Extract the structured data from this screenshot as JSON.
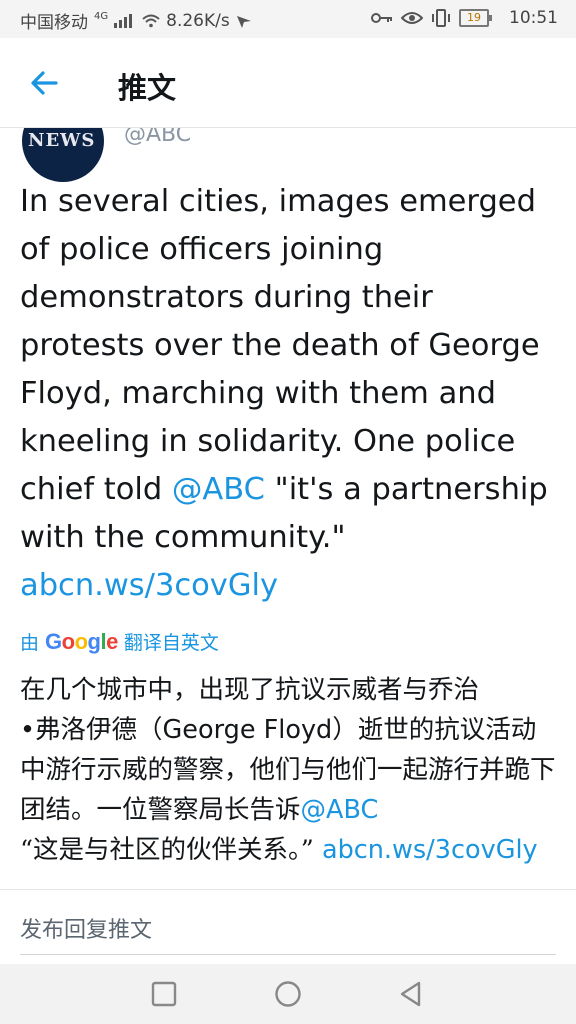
{
  "status_bar": {
    "carrier": "中国移动",
    "network": "4G",
    "speed": "8.26K/s",
    "battery": "19",
    "time": "10:51"
  },
  "header": {
    "title": "推文"
  },
  "tweet": {
    "avatar_text": "NEWS",
    "handle": "@ABC",
    "text_before_mention": "In several cities, images emerged of police officers joining demonstrators during their protests over the death of George Floyd, marching with them and kneeling in solidarity. One police chief told ",
    "mention": "@ABC",
    "text_after_mention": " \"it's a partnership with the community.\" ",
    "link": "abcn.ws/3covGly"
  },
  "translation": {
    "prefix": "由",
    "provider": "Google",
    "suffix": "翻译自英文",
    "text_1": "在几个城市中，出现了抗议示威者与乔治",
    "text_2_cn_dot": "•弗洛伊德（",
    "text_2_latin": "George Floyd",
    "text_2_rest": "）逝世的抗议活动中游行示威的警察，他们与他们一起游行并跪下团结。一位警察局长告诉",
    "mention": "@ABC",
    "text_3": "“这是与社区的伙伴关系。” ",
    "link": "abcn.ws/3covGly"
  },
  "reply": {
    "placeholder": "发布回复推文"
  },
  "colors": {
    "link": "#1b95e0",
    "text": "#14171a",
    "avatar_bg": "#0d2346"
  }
}
